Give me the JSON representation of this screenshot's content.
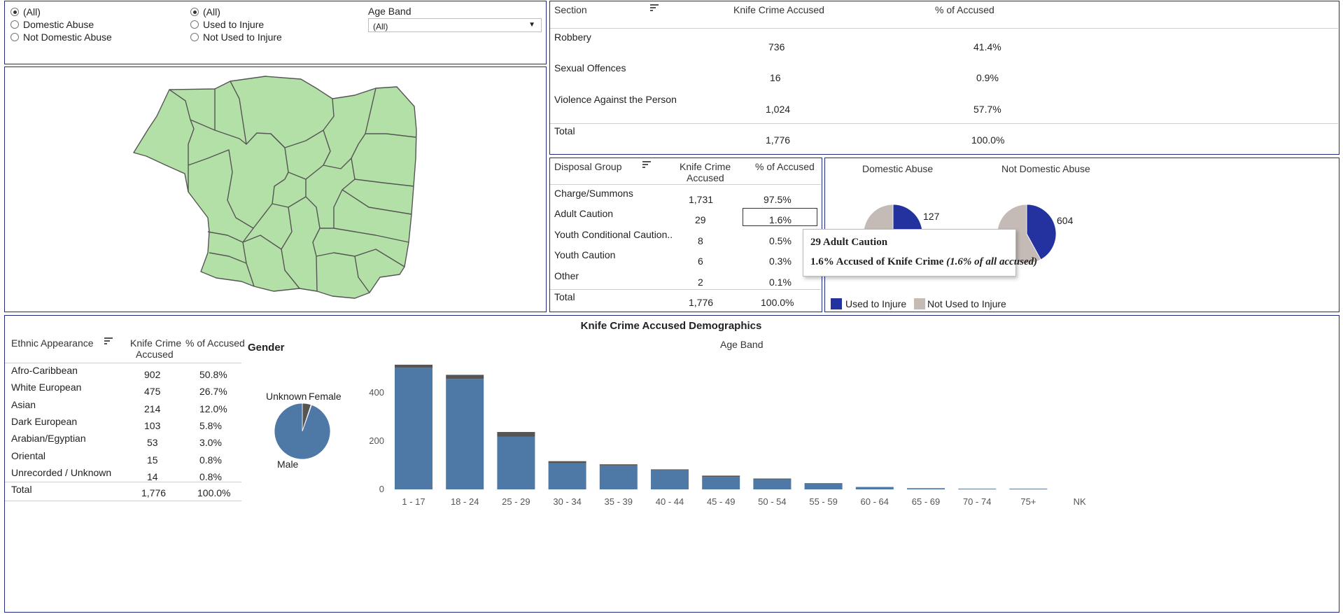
{
  "filters": {
    "domestic_abuse": {
      "options": [
        {
          "label": "(All)",
          "selected": true
        },
        {
          "label": "Domestic Abuse",
          "selected": false
        },
        {
          "label": "Not Domestic Abuse",
          "selected": false
        }
      ]
    },
    "used_to_injure": {
      "options": [
        {
          "label": "(All)",
          "selected": true
        },
        {
          "label": "Used to Injure",
          "selected": false
        },
        {
          "label": "Not Used to Injure",
          "selected": false
        }
      ]
    },
    "age_band": {
      "label": "Age Band",
      "value": "(All)"
    }
  },
  "section_table": {
    "headers": [
      "Section",
      "Knife Crime Accused",
      "% of Accused"
    ],
    "rows": [
      {
        "label": "Robbery",
        "count": "736",
        "pct": "41.4%"
      },
      {
        "label": "Sexual Offences",
        "count": "16",
        "pct": "0.9%"
      },
      {
        "label": "Violence Against the Person",
        "count": "1,024",
        "pct": "57.7%"
      },
      {
        "label": "Total",
        "count": "1,776",
        "pct": "100.0%"
      }
    ]
  },
  "disposal_table": {
    "headers": [
      "Disposal Group",
      "Knife Crime",
      "Accused",
      "% of Accused"
    ],
    "rows": [
      {
        "label": "Charge/Summons",
        "count": "1,731",
        "pct": "97.5%"
      },
      {
        "label": "Adult Caution",
        "count": "29",
        "pct": "1.6%"
      },
      {
        "label": "Youth Conditional Caution..",
        "count": "8",
        "pct": "0.5%"
      },
      {
        "label": "Youth Caution",
        "count": "6",
        "pct": "0.3%"
      },
      {
        "label": "Other",
        "count": "2",
        "pct": "0.1%"
      },
      {
        "label": "Total",
        "count": "1,776",
        "pct": "100.0%"
      }
    ]
  },
  "tooltip": {
    "line1": "29 Adult Caution",
    "line2": "1.6% Accused of Knife Crime",
    "line2_italic": "(1.6% of all accused)"
  },
  "abuse_pies": {
    "titles": [
      "Domestic Abuse",
      "Not Domestic Abuse"
    ],
    "values": [
      "127",
      "604"
    ],
    "used_fraction": [
      0.4,
      0.42
    ],
    "legend": [
      "Used to Injure",
      "Not Used to Injure"
    ],
    "colors": {
      "used": "#2432a0",
      "not_used": "#c4bbb6"
    }
  },
  "ethnic_table": {
    "headers": [
      "Ethnic Appearance",
      "Knife Crime",
      "Accused",
      "% of Accused"
    ],
    "rows": [
      {
        "label": "Afro-Caribbean",
        "count": "902",
        "pct": "50.8%"
      },
      {
        "label": "White European",
        "count": "475",
        "pct": "26.7%"
      },
      {
        "label": "Asian",
        "count": "214",
        "pct": "12.0%"
      },
      {
        "label": "Dark European",
        "count": "103",
        "pct": "5.8%"
      },
      {
        "label": "Arabian/Egyptian",
        "count": "53",
        "pct": "3.0%"
      },
      {
        "label": "Oriental",
        "count": "15",
        "pct": "0.8%"
      },
      {
        "label": "Unrecorded / Unknown",
        "count": "14",
        "pct": "0.8%"
      },
      {
        "label": "Total",
        "count": "1,776",
        "pct": "100.0%"
      }
    ]
  },
  "demographics": {
    "title": "Knife Crime Accused Demographics",
    "gender_title": "Gender",
    "gender_labels": {
      "unknown": "Unknown",
      "female": "Female",
      "male": "Male"
    }
  },
  "chart_data": [
    {
      "type": "pie",
      "title": "Gender",
      "labels": [
        "Male",
        "Female",
        "Unknown"
      ],
      "values": [
        1680,
        90,
        6
      ],
      "colors": [
        "#4e79a7",
        "#555555",
        "#3aa655"
      ]
    },
    {
      "type": "bar",
      "title": "Age Band",
      "categories": [
        "1 - 17",
        "18 - 24",
        "25 - 29",
        "30 - 34",
        "35 - 39",
        "40 - 44",
        "45 - 49",
        "50 - 54",
        "55 - 59",
        "60 - 64",
        "65 - 69",
        "70 - 74",
        "75+",
        "NK"
      ],
      "series": [
        {
          "values": [
            505,
            458,
            218,
            108,
            99,
            80,
            52,
            42,
            25,
            9,
            4,
            2,
            2,
            0
          ]
        },
        {
          "values": [
            12,
            17,
            20,
            9,
            5,
            3,
            5,
            3,
            1,
            1,
            1,
            1,
            1,
            0
          ]
        }
      ],
      "colors": [
        "#4e79a7",
        "#555555"
      ],
      "yticks": [
        0,
        200,
        400
      ],
      "ylim": [
        0,
        540
      ]
    }
  ],
  "map": {
    "fill": "#b3e0a6",
    "stroke": "#555555"
  }
}
